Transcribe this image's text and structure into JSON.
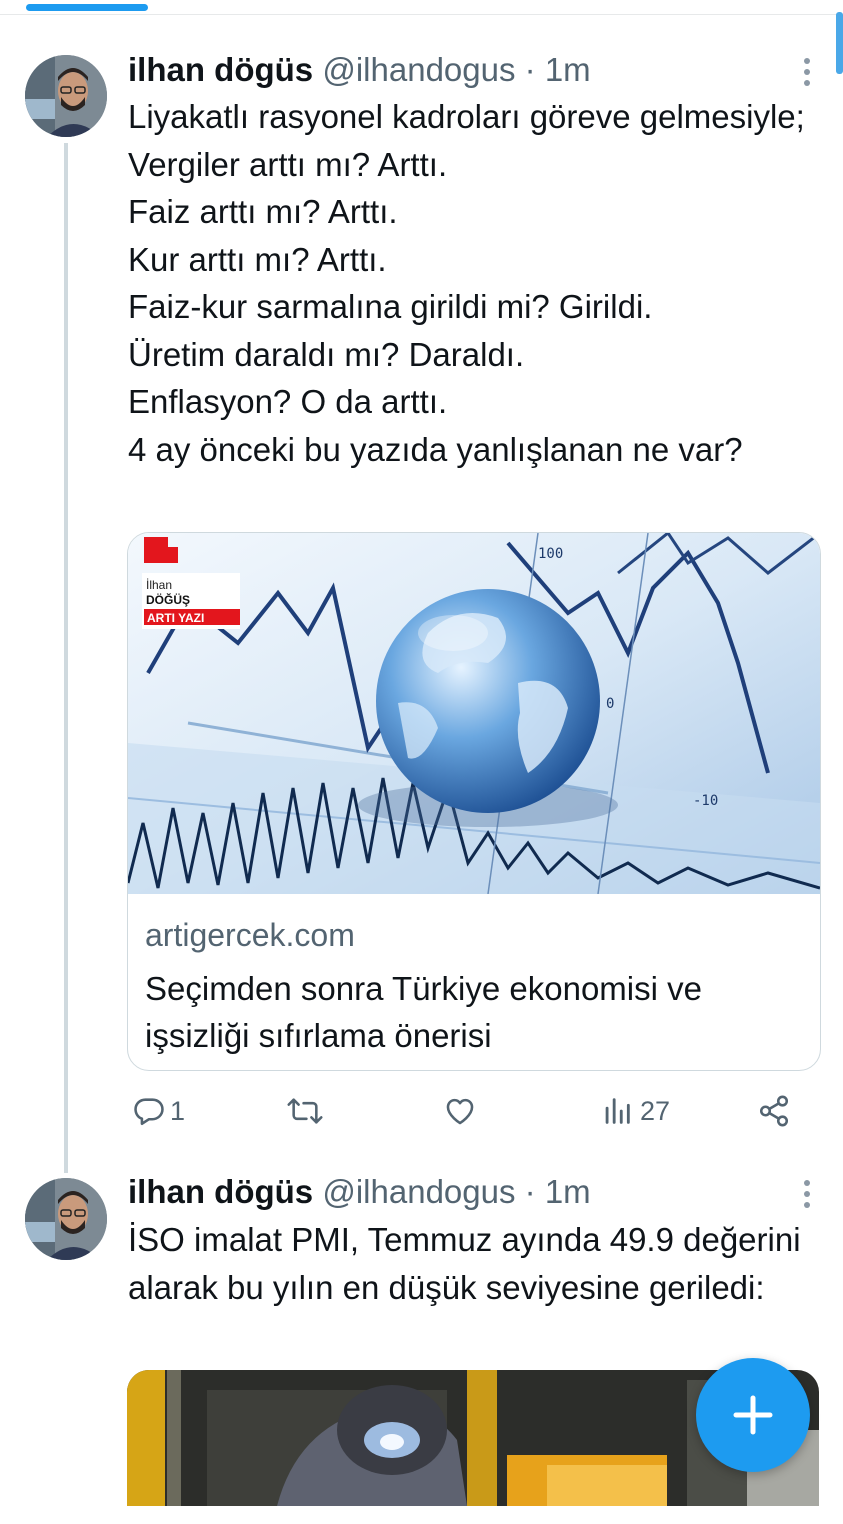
{
  "tweets": [
    {
      "name": "ilhan dögüs",
      "handle": "@ilhandogus",
      "time": "1m",
      "text": "Liyakatlı rasyonel kadroları göreve gelmesiyle;\nVergiler arttı mı? Arttı.\nFaiz arttı mı? Arttı.\nKur arttı mı? Arttı.\nFaiz-kur sarmalına girildi mi? Girildi.\nÜretim daraldı mı? Daraldı.\nEnflasyon? O da arttı.\n4 ay önceki bu yazıda yanlışlanan ne var?",
      "card": {
        "logo_line1": "İlhan",
        "logo_line2": "DÖĞÜŞ",
        "logo_line3": "ARTI YAZI",
        "chart_label_100": "100",
        "chart_label_0": "0",
        "chart_label_minus10": "-10",
        "domain": "artigercek.com",
        "title": "Seçimden sonra Türkiye ekonomisi ve işsizliği sıfırlama önerisi"
      },
      "actions": {
        "reply_count": "1",
        "views_count": "27"
      }
    },
    {
      "name": "ilhan dögüs",
      "handle": "@ilhandogus",
      "time": "1m",
      "text": "İSO imalat PMI, Temmuz ayında 49.9 değerini alarak bu yılın en düşük seviyesine geriledi:"
    }
  ],
  "colors": {
    "accent": "#1d9bf0",
    "secondary_text": "#536471",
    "border": "#cfd9de"
  },
  "icons": [
    "reply-icon",
    "retweet-icon",
    "like-icon",
    "views-icon",
    "share-icon",
    "more-icon",
    "compose-plus-icon"
  ]
}
